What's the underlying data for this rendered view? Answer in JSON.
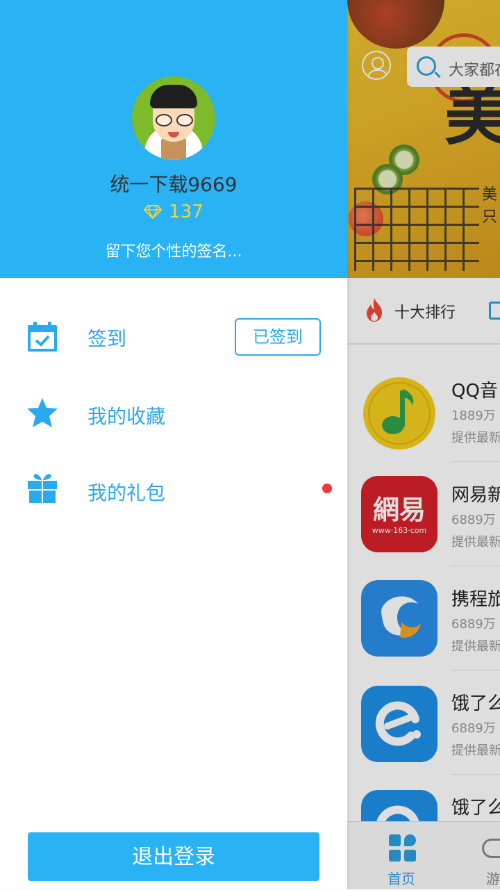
{
  "background_app": {
    "search_placeholder": "大家都在",
    "banner_big_char": "美",
    "banner_sub1": "美",
    "banner_sub2": "只",
    "tab_label": "十大排行",
    "apps": [
      {
        "name": "QQ音",
        "meta": "1889万",
        "desc": "提供最新",
        "icon": "qq-music-icon"
      },
      {
        "name": "网易新",
        "meta": "6889万",
        "desc": "提供最新",
        "icon": "netease-icon"
      },
      {
        "name": "携程旅",
        "meta": "6889万",
        "desc": "提供最新",
        "icon": "ctrip-icon"
      },
      {
        "name": "饿了么",
        "meta": "6889万",
        "desc": "提供最新",
        "icon": "eleme-icon"
      },
      {
        "name": "饿了么",
        "meta": "",
        "desc": "",
        "icon": "eleme-icon"
      }
    ],
    "netease_logo_text": "網易",
    "netease_logo_sub": "www·163·com",
    "bottom_nav": {
      "home": "首页",
      "games": "游"
    }
  },
  "drawer": {
    "username": "统一下载9669",
    "points": "137",
    "signature": "留下您个性的签名...",
    "menu": [
      {
        "label": "签到",
        "icon": "calendar-check-icon"
      },
      {
        "label": "我的收藏",
        "icon": "star-icon"
      },
      {
        "label": "我的礼包",
        "icon": "gift-icon"
      }
    ],
    "checkin_button": "已签到",
    "logout_button": "退出登录"
  },
  "colors": {
    "accent": "#29b3f4",
    "text_blue": "#29a9ee",
    "gold": "#f5d43a",
    "notify_red": "#f5343c"
  }
}
